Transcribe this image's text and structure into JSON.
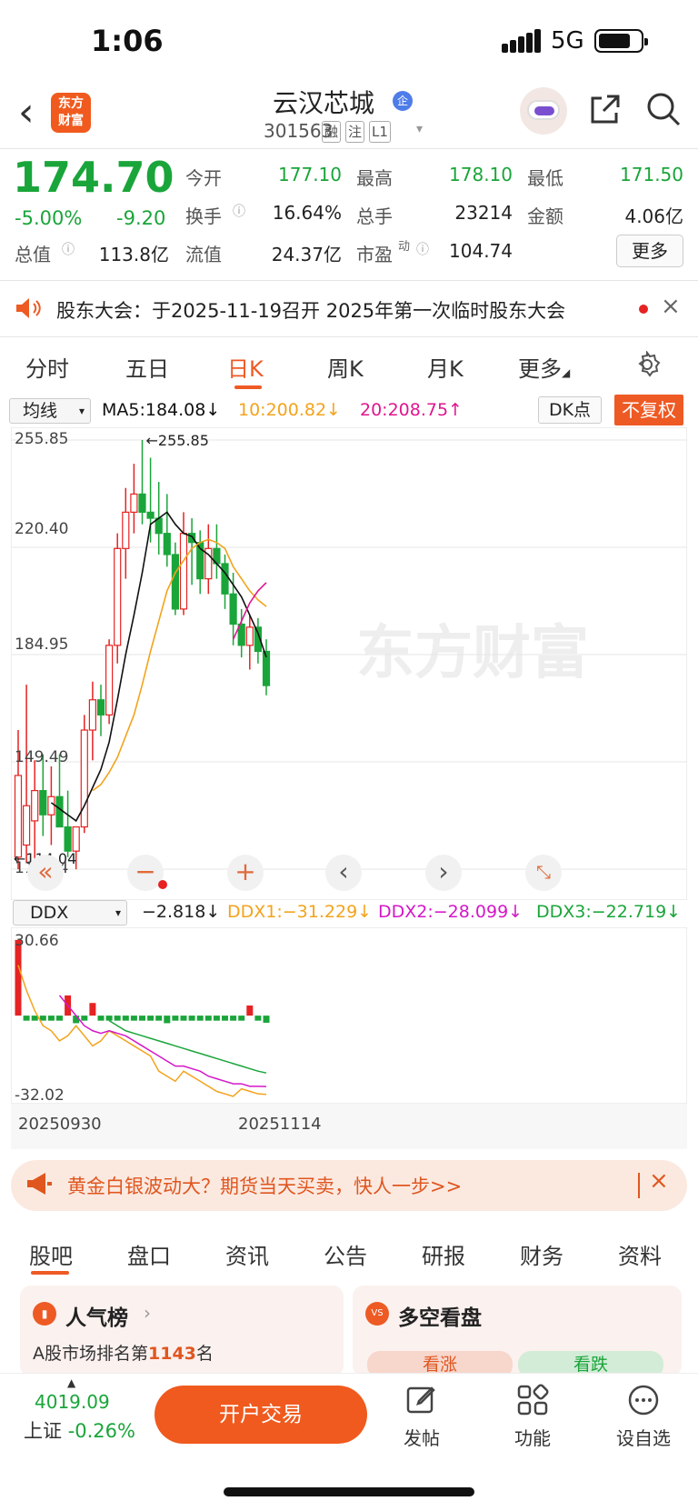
{
  "status": {
    "time": "1:06",
    "network": "5G"
  },
  "header": {
    "logo_line1": "东方",
    "logo_line2": "财富",
    "stock_name": "云汉芯城",
    "badge": "企",
    "stock_code": "301563",
    "tags": [
      "融",
      "注",
      "L1"
    ]
  },
  "quote": {
    "price": "174.70",
    "change_pct": "-5.00%",
    "change": "-9.20",
    "fields": [
      {
        "label": "今开",
        "value": "177.10"
      },
      {
        "label": "最高",
        "value": "178.10"
      },
      {
        "label": "最低",
        "value": "171.50"
      },
      {
        "label": "换手",
        "value": "16.64%"
      },
      {
        "label": "总手",
        "value": "23214"
      },
      {
        "label": "金额",
        "value": "4.06亿"
      },
      {
        "label": "总值",
        "value": "113.8亿"
      },
      {
        "label": "流值",
        "value": "24.37亿"
      },
      {
        "label": "市盈",
        "label_sup": "动",
        "value": "104.74"
      }
    ],
    "more_label": "更多"
  },
  "notice": {
    "text": "股东大会：于2025-11-19召开 2025年第一次临时股东大会"
  },
  "chart_tabs": [
    {
      "label": "分时"
    },
    {
      "label": "五日"
    },
    {
      "label": "日K",
      "active": true
    },
    {
      "label": "周K"
    },
    {
      "label": "月K"
    },
    {
      "label": "更多"
    }
  ],
  "indicators": {
    "ma_select": "均线",
    "ma5": "MA5:184.08↓",
    "ma10": "10:200.82↓",
    "ma20": "20:208.75↑",
    "dk_label": "DK点",
    "fq_label": "不复权",
    "ddx_select": "DDX",
    "ddx": "−2.818↓",
    "ddx1": "DDX1:−31.229↓",
    "ddx2": "DDX2:−28.099↓",
    "ddx3": "DDX3:−22.719↓"
  },
  "colors": {
    "up": "#e62222",
    "down": "#1aa53a",
    "ma5": "#111111",
    "ma10": "#f3a31c",
    "ma20": "#e0168f",
    "accent": "#ee5a24"
  },
  "watermark": "东方财富",
  "chart_data": {
    "type": "candlestick",
    "ylabels": [
      "255.85",
      "220.40",
      "184.95",
      "149.49",
      "114.04"
    ],
    "ylim": [
      114.04,
      255.85
    ],
    "max_label": "←255.85",
    "min_label": "←114.04",
    "ddx_ylabels": [
      "30.66",
      "-32.02"
    ],
    "x_start": "20250930",
    "x_end": "20251114",
    "candles": [
      [
        118,
        160,
        114,
        145
      ],
      [
        122,
        175,
        116,
        135
      ],
      [
        130,
        150,
        115,
        140
      ],
      [
        140,
        152,
        125,
        132
      ],
      [
        132,
        148,
        122,
        138
      ],
      [
        138,
        152,
        128,
        128
      ],
      [
        128,
        140,
        118,
        120
      ],
      [
        120,
        128,
        114,
        128
      ],
      [
        128,
        165,
        126,
        160
      ],
      [
        160,
        176,
        150,
        170
      ],
      [
        170,
        175,
        158,
        165
      ],
      [
        165,
        190,
        162,
        188
      ],
      [
        188,
        225,
        182,
        220
      ],
      [
        220,
        240,
        210,
        232
      ],
      [
        232,
        248,
        225,
        238
      ],
      [
        238,
        255.85,
        228,
        232
      ],
      [
        232,
        250,
        222,
        230
      ],
      [
        230,
        242,
        218,
        225
      ],
      [
        225,
        238,
        214,
        218
      ],
      [
        218,
        222,
        198,
        200
      ],
      [
        200,
        232,
        198,
        225
      ],
      [
        225,
        230,
        208,
        222
      ],
      [
        222,
        226,
        205,
        210
      ],
      [
        210,
        228,
        205,
        220
      ],
      [
        220,
        228,
        210,
        215
      ],
      [
        215,
        218,
        200,
        205
      ],
      [
        205,
        212,
        188,
        195
      ],
      [
        195,
        200,
        184,
        188
      ],
      [
        188,
        198,
        180,
        194
      ],
      [
        194,
        197,
        182,
        186
      ],
      [
        186,
        190,
        171.5,
        174.7
      ]
    ],
    "ma5": [
      null,
      null,
      null,
      null,
      136,
      134,
      132,
      130,
      135,
      141,
      147,
      156,
      170,
      185,
      198,
      212,
      228,
      230,
      232,
      228,
      225,
      224,
      220,
      218,
      215,
      212,
      208,
      204,
      198,
      192,
      184.08
    ],
    "ma10": [
      null,
      null,
      null,
      null,
      null,
      null,
      null,
      null,
      null,
      140,
      142,
      146,
      151,
      158,
      165,
      175,
      186,
      196,
      206,
      212,
      216,
      220,
      222,
      223,
      222,
      220,
      214,
      210,
      206,
      203,
      200.82
    ],
    "ma20": [
      null,
      null,
      null,
      null,
      null,
      null,
      null,
      null,
      null,
      null,
      null,
      null,
      null,
      null,
      null,
      null,
      null,
      null,
      null,
      null,
      null,
      null,
      null,
      null,
      null,
      null,
      190,
      196,
      202,
      206,
      208.75
    ],
    "ddx_bars": [
      30,
      -2,
      -2,
      -2,
      -2,
      -2,
      8,
      -3,
      -2,
      5,
      -2,
      -2,
      -2,
      -2,
      -2,
      -2,
      -2,
      -2,
      -3,
      -2,
      -2,
      -2,
      -2,
      -2,
      -2,
      -2,
      -2,
      -2,
      4,
      -2,
      -2.818
    ],
    "ddx1": [
      20,
      10,
      2,
      -4,
      -6,
      -10,
      -8,
      -4,
      -8,
      -12,
      -10,
      -6,
      -8,
      -10,
      -12,
      -14,
      -16,
      -22,
      -24,
      -26,
      -22,
      -24,
      -26,
      -28,
      -30,
      -31,
      -32,
      -29,
      -30,
      -31,
      -31.229
    ],
    "ddx2": [
      null,
      null,
      null,
      null,
      null,
      8,
      4,
      0,
      -4,
      -6,
      -7,
      -6,
      -7,
      -8,
      -10,
      -12,
      -14,
      -16,
      -18,
      -20,
      -20,
      -21,
      -22,
      -24,
      -25,
      -26,
      -27,
      -27,
      -28,
      -28,
      -28.099
    ],
    "ddx3": [
      null,
      null,
      null,
      null,
      null,
      null,
      null,
      null,
      null,
      null,
      null,
      -2,
      -4,
      -6,
      -7,
      -8,
      -9,
      -10,
      -11,
      -12,
      -13,
      -14,
      -15,
      -16,
      -17,
      -18,
      -19,
      -20,
      -21,
      -22,
      -22.719
    ]
  },
  "ad": {
    "text": "黄金白银波动大？期货当天买卖，快人一步>>"
  },
  "bottom_tabs": [
    {
      "label": "股吧",
      "active": true
    },
    {
      "label": "盘口"
    },
    {
      "label": "资讯"
    },
    {
      "label": "公告"
    },
    {
      "label": "研报"
    },
    {
      "label": "财务"
    },
    {
      "label": "资料"
    }
  ],
  "cards": {
    "popularity_title": "人气榜",
    "popularity_text_prefix": "A股市场排名第",
    "popularity_rank": "1143",
    "popularity_text_suffix": "名",
    "longshort_title": "多空看盘",
    "up_label": "看涨",
    "down_label": "看跌"
  },
  "bottombar": {
    "index_value": "4019.09",
    "index_name": "上证",
    "index_change": "-0.26%",
    "trade_label": "开户交易",
    "post_label": "发帖",
    "func_label": "功能",
    "fav_label": "设自选"
  }
}
